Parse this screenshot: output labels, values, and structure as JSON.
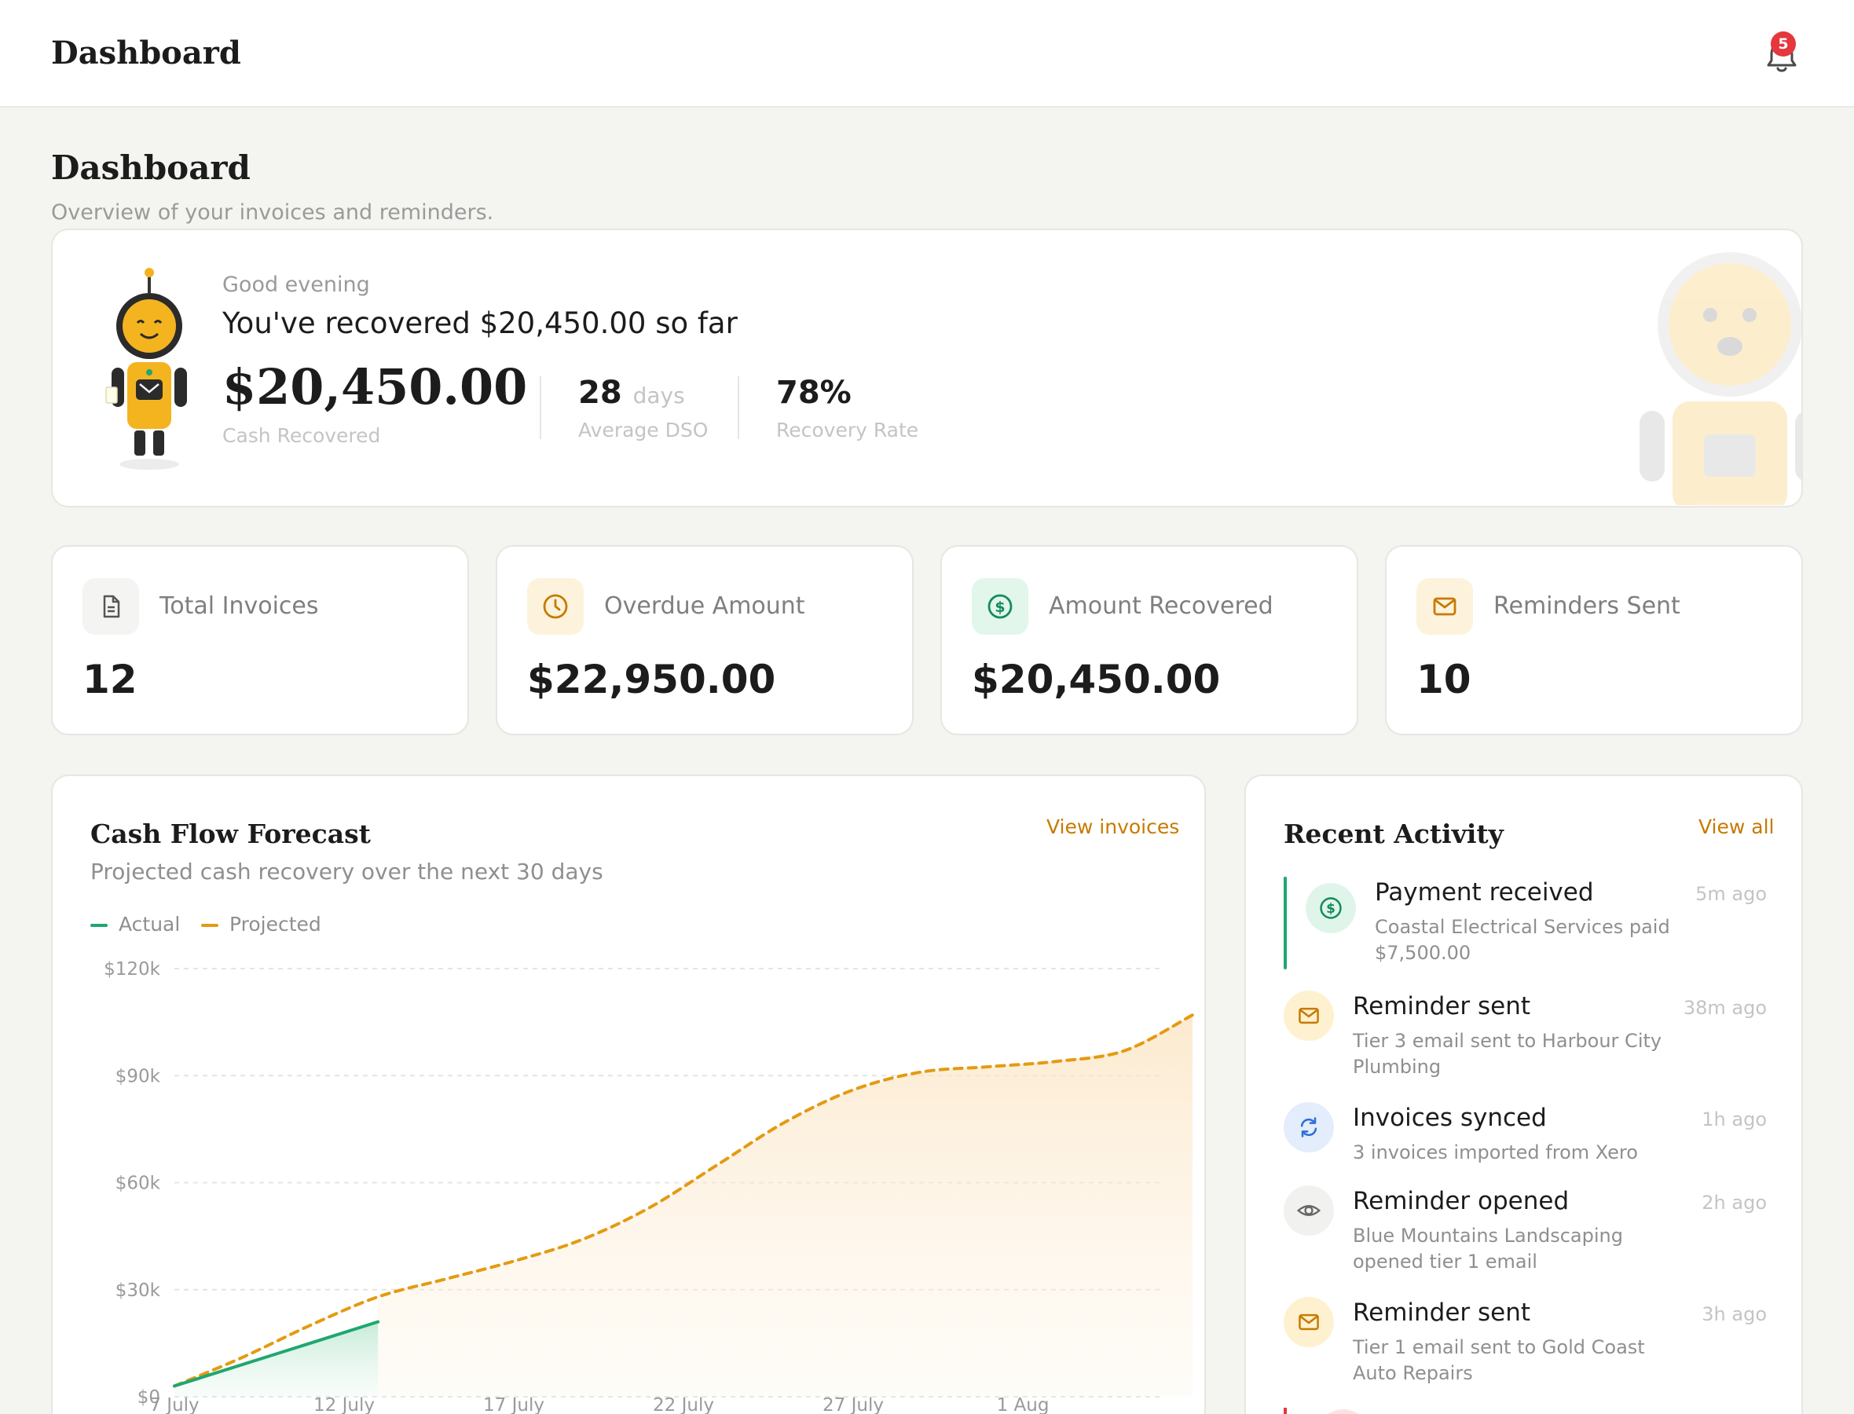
{
  "topbar": {
    "title": "Dashboard",
    "notification_count": "5"
  },
  "header": {
    "title": "Dashboard",
    "subtitle": "Overview of your invoices and reminders."
  },
  "hero": {
    "greeting": "Good evening",
    "headline": "You've recovered $20,450.00 so far",
    "amount": "$20,450.00",
    "amount_label": "Cash Recovered",
    "dso_value": "28",
    "dso_unit": "days",
    "dso_label": "Average DSO",
    "rate_value": "78%",
    "rate_label": "Recovery Rate"
  },
  "kpis": [
    {
      "label": "Total Invoices",
      "value": "12",
      "icon": "document-icon"
    },
    {
      "label": "Overdue Amount",
      "value": "$22,950.00",
      "icon": "clock-icon"
    },
    {
      "label": "Amount Recovered",
      "value": "$20,450.00",
      "icon": "dollar-icon"
    },
    {
      "label": "Reminders Sent",
      "value": "10",
      "icon": "mail-icon"
    }
  ],
  "forecast": {
    "title": "Cash Flow Forecast",
    "subtitle": "Projected cash recovery over the next 30 days",
    "link": "View invoices",
    "legend_actual": "Actual",
    "legend_projected": "Projected"
  },
  "chart_data": {
    "type": "line",
    "title": "Cash Flow Forecast",
    "x_ticks": [
      "7 July",
      "12 July",
      "17 July",
      "22 July",
      "27 July",
      "1 Aug"
    ],
    "y_ticks": [
      "$0",
      "$30k",
      "$60k",
      "$90k",
      "$120k"
    ],
    "ylim": [
      0,
      120000
    ],
    "grid": true,
    "legend": "top-left",
    "series": [
      {
        "name": "Actual",
        "color": "#1fa770",
        "x": [
          "7 July",
          "13 July"
        ],
        "values": [
          3000,
          21000
        ]
      },
      {
        "name": "Projected",
        "color": "#e39b12",
        "x": [
          "7 July",
          "9 July",
          "11 July",
          "13 July",
          "15 July",
          "17 July",
          "19 July",
          "21 July",
          "23 July",
          "25 July",
          "27 July",
          "29 July",
          "31 July",
          "2 Aug",
          "4 Aug",
          "6 Aug"
        ],
        "values": [
          3000,
          11000,
          20000,
          28000,
          33000,
          38000,
          44000,
          53000,
          65000,
          77000,
          86000,
          91000,
          92500,
          94000,
          97000,
          107000
        ]
      }
    ]
  },
  "activity": {
    "title": "Recent Activity",
    "link": "View all",
    "items": [
      {
        "name": "Payment received",
        "desc": "Coastal Electrical Services paid $7,500.00",
        "time": "5m ago",
        "icon": "dollar-icon"
      },
      {
        "name": "Reminder sent",
        "desc": "Tier 3 email sent to Harbour City Plumbing",
        "time": "38m ago",
        "icon": "mail-icon"
      },
      {
        "name": "Invoices synced",
        "desc": "3 invoices imported from Xero",
        "time": "1h ago",
        "icon": "sync-icon"
      },
      {
        "name": "Reminder opened",
        "desc": "Blue Mountains Landscaping opened tier 1 email",
        "time": "2h ago",
        "icon": "eye-icon"
      },
      {
        "name": "Reminder sent",
        "desc": "Tier 1 email sent to Gold Coast Auto Repairs",
        "time": "3h ago",
        "icon": "mail-icon"
      }
    ]
  },
  "colors": {
    "accent": "#c77a00",
    "green": "#1fa770",
    "orange": "#e39b12",
    "badge": "#e5373c"
  }
}
